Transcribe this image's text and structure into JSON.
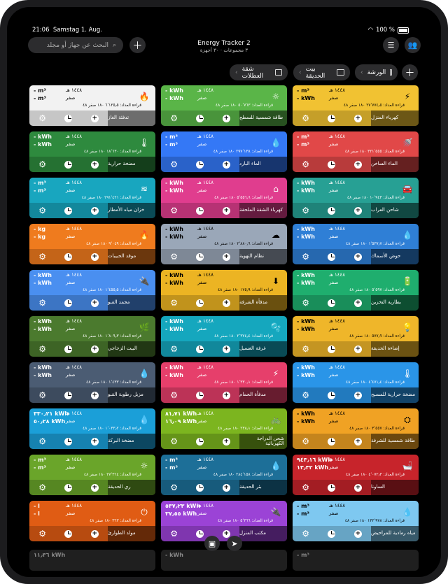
{
  "status": {
    "time": "21:06",
    "date": "Samstag 1. Aug.",
    "battery": "100 %"
  },
  "header": {
    "search_placeholder": "البحث عن جهاز أو مجلد",
    "title": "Energy Tracker 2",
    "subtitle": "٣ مجموعات · ٣٠ أجهزة",
    "folders": [
      {
        "label": "الورشة"
      },
      {
        "label": "بيت الحديقة"
      },
      {
        "label": "شقة العطلات"
      }
    ]
  },
  "labels": {
    "hijri": "١٤٤٨ هـ",
    "zero": "صفر",
    "meter_prefix": "قراءة العداد"
  },
  "cards": [
    {
      "name": "كهرباء المنزل",
      "v1": "- m³",
      "v2": "- kWh",
      "meter": "قراءة العداد: ٢٧٬٧٧٤٫٥ ١٨٠ صفر ٤٨",
      "color": "#f1c232",
      "textColor": "#000",
      "icon": "⚡"
    },
    {
      "name": "طاقة شمسية للسطح",
      "v1": "- kWh",
      "v2": "- kWh",
      "meter": "قراءة العداد: ٥٠٬٧٦٣ ١٨٠ صفر ٤٨",
      "color": "#5ab548",
      "textColor": "#fff",
      "icon": "☼"
    },
    {
      "name": "تدفئة الغاز",
      "v1": "- m³",
      "v2": "- m³",
      "meter": "قراءة العداد: ٦٬١٢٥٫٥ ١٨٠ صفر ٤٨",
      "color": "#f2f2f2",
      "textColor": "#000",
      "icon": "🔥"
    },
    {
      "name": "الماء الساخن",
      "v1": "- m³",
      "v2": "- m³",
      "meter": "قراءة العداد: ٣٢١٬٥٥٥ ١٨٠ صفر ٤٨",
      "color": "#e14848",
      "textColor": "#fff",
      "icon": "🚿"
    },
    {
      "name": "الماء البارد",
      "v1": "- m³",
      "v2": "- m³",
      "meter": "قراءة العداد: ٢٩٧٬١٣٨ ١٨٠ صفر ٤٨",
      "color": "#3478f6",
      "textColor": "#fff",
      "icon": "💧"
    },
    {
      "name": "مضخة حرارية",
      "v1": "- kWh",
      "v2": "- kWh",
      "meter": "قراءة العداد: ١٨٬٦٣٠ ١٨٠ صفر ٤٨",
      "color": "#2e8a3e",
      "textColor": "#fff",
      "icon": "🌡"
    },
    {
      "name": "شاحن العراب",
      "v1": "- kWh",
      "v2": "- kWh",
      "meter": "قراءة العداد: ١٠٬٩٤٣ ١٨٠ صفر ٤٨",
      "color": "#27a094",
      "textColor": "#fff",
      "icon": "🚘"
    },
    {
      "name": "كهرباء الشقة الملحقة",
      "v1": "- kWh",
      "v2": "- kWh",
      "meter": "قراءة العداد: ٥٬٥٥٦٫٦ ١٨٠ صفر ٤٨",
      "color": "#e03d8e",
      "textColor": "#fff",
      "icon": "⌂"
    },
    {
      "name": "خزان مياه الأمطار",
      "v1": "- m³",
      "v2": "- m³",
      "meter": "قراءة العداد: ٢٩١٬٤٢١ ١٨٠ صفر ٤٨",
      "color": "#18a6bf",
      "textColor": "#fff",
      "icon": "≋"
    },
    {
      "name": "حوض الأسماك",
      "v1": "- kWh",
      "v2": "- kWh",
      "meter": "قراءة العداد: ١٬٥٣٧٫٧ ١٨٠ صفر ٤٨",
      "color": "#2f7fd6",
      "textColor": "#fff",
      "icon": "💧"
    },
    {
      "name": "نظام التهوية",
      "v1": "- kWh",
      "v2": "- kWh",
      "meter": "قراءة العداد: ٢٬٨٨٠٫٦ ١٨٠ صفر ٤٨",
      "color": "#9aa7b8",
      "textColor": "#000",
      "icon": "☁"
    },
    {
      "name": "موقد الحبيبات",
      "v1": "- kg",
      "v2": "- kg",
      "meter": "قراءة العداد: ٩٬٠٤٩ ١٨٠ صفر ٤٨",
      "color": "#ef7b1e",
      "textColor": "#fff",
      "icon": "🔥"
    },
    {
      "name": "بطارية التخزين",
      "v1": "- kWh",
      "v2": "- kWh",
      "meter": "قراءة العداد: ٥٬٥٩٧ ١٨٠ صفر ٤٨",
      "color": "#1fae6e",
      "textColor": "#fff",
      "icon": "🔋"
    },
    {
      "name": "مدفأة الشرفة",
      "v1": "- kWh",
      "v2": "- kWh",
      "meter": "قراءة العداد: ١٧٥٫٩ ١٨٠ صفر ٤٨",
      "color": "#ecb423",
      "textColor": "#000",
      "icon": "⬇"
    },
    {
      "name": "مجمد القبو",
      "v1": "- kWh",
      "v2": "- kWh",
      "meter": "قراءة العداد: ١٬٤٥٥٫٥ ١٨٠ صفر ٤٨",
      "color": "#4a8ff0",
      "textColor": "#fff",
      "icon": "🔌"
    },
    {
      "name": "إضاءة الحديقة",
      "v1": "- kWh",
      "v2": "- kWh",
      "meter": "قراءة العداد: ٥٧٧٫٩ ١٨٠ صفر ٤٨",
      "color": "#efb62a",
      "textColor": "#000",
      "icon": "💡"
    },
    {
      "name": "غرفة الغسيل",
      "v1": "- kWh",
      "v2": "- kWh",
      "meter": "قراءة العداد: ٢٬٣٧٤٫٤ ١٨٠ صفر ٤٨",
      "color": "#15a7be",
      "textColor": "#fff",
      "icon": "🫧"
    },
    {
      "name": "البيت الزجاجي",
      "v1": "- kWh",
      "v2": "- kWh",
      "meter": "قراءة العداد: ١٬٨٠٩٫٣ ١٨٠ صفر ٤٨",
      "color": "#4b7a2e",
      "textColor": "#fff",
      "icon": "🌿"
    },
    {
      "name": "مضخة حرارية للمسبح",
      "v1": "- kWh",
      "v2": "- kWh",
      "meter": "قراءة العداد: ٤٬٤٧١٫٤ ١٨٠ صفر ٤٨",
      "color": "#2a95e8",
      "textColor": "#fff",
      "icon": "🌡"
    },
    {
      "name": "مدفأة الحمام",
      "v1": "- kWh",
      "v2": "- kWh",
      "meter": "قراءة العداد: ١٬٣٣٠٫١ ١٨٠ صفر ٤٨",
      "color": "#e63f6b",
      "textColor": "#fff",
      "icon": "⚡"
    },
    {
      "name": "مزيل رطوبة القبو",
      "v1": "- kWh",
      "v2": "- kWh",
      "meter": "قراءة العداد: ١٬٤٣٣ ١٨٠ صفر ٤٨",
      "color": "#4b5c73",
      "textColor": "#fff",
      "icon": "💧"
    },
    {
      "name": "طاقة شمسية للشرفة",
      "v1": "- kWh",
      "v2": "- kWh",
      "meter": "قراءة العداد: ٣٬٥٥٧ ١٨٠ صفر ٤٨",
      "color": "#f0a224",
      "textColor": "#000",
      "icon": "⛭"
    },
    {
      "name": "شحن الدراجة الكهربائية",
      "v1": "٨١٫٧١ kWh",
      "v2": "١٦٫٠٩ kWh",
      "meter": "قراءة العداد: ٢٣٨٫١ ١٨٠ صفر ٤٨",
      "color": "#7cb51f",
      "textColor": "#fff",
      "icon": "🚲"
    },
    {
      "name": "مضخة البركة",
      "v1": "٣٣٠٫٢١ kWh",
      "v2": "٥٠٫٢٨ kWh",
      "meter": "قراءة العداد: ١٬٠٣٣٫٢ ١٨٠ صفر ٤٨",
      "color": "#1b9fd8",
      "textColor": "#fff",
      "icon": "💧"
    },
    {
      "name": "الساونا",
      "v1": "٩٤٣٫١٦ kWh",
      "v2": "١٣٫٣٢ kWh",
      "meter": "قراءة العداد: ٤٬٠٧٢٫٣ ١٨٠ صفر ٤٨",
      "color": "#c7242b",
      "textColor": "#fff",
      "icon": "🛁"
    },
    {
      "name": "بئر الحديقة",
      "v1": "- m³",
      "v2": "- m³",
      "meter": "قراءة العداد: ٢٨٤٬١٥٨ ١٨٠ صفر ٤٨",
      "color": "#1d6f98",
      "textColor": "#fff",
      "icon": "💧"
    },
    {
      "name": "ري الحديقة",
      "v1": "- m³",
      "v2": "- m³",
      "meter": "قراءة العداد: ٢٧٬٣٦٤ ١٨٠ صفر ٤٨",
      "color": "#6aa52a",
      "textColor": "#fff",
      "icon": "☼"
    },
    {
      "name": "مياه رمادية للمراحيض",
      "v1": "- m³",
      "v2": "- m³",
      "meter": "قراءة العداد: ١٣٢٬٩٧٨ ١٨٠ صفر ٤٨",
      "color": "#7ec8f0",
      "textColor": "#000",
      "icon": "💧"
    },
    {
      "name": "مكتب المنزل",
      "v1": "٥٣٧٫٢٣ kWh",
      "v2": "٣٧٫٥٥ kWh",
      "meter": "قراءة العداد: ٥٬٣٦٦ ١٨٠ صفر ٤٨",
      "color": "#9b43d6",
      "textColor": "#fff",
      "icon": "🔌"
    },
    {
      "name": "مولد الطوارئ",
      "v1": "- l",
      "v2": "- l",
      "meter": "قراءة العداد: ٣٦٣ ١٨٠ صفر ٤٨",
      "color": "#e05c14",
      "textColor": "#fff",
      "icon": "⏻"
    }
  ],
  "partial_row": [
    {
      "v1": "١١٫٣٦ kWh",
      "color": "#1f1f1f"
    },
    {
      "v1": "- kWh",
      "color": "#1f1f1f"
    },
    {
      "v1": "- m³",
      "color": "#1f1f1f"
    }
  ]
}
